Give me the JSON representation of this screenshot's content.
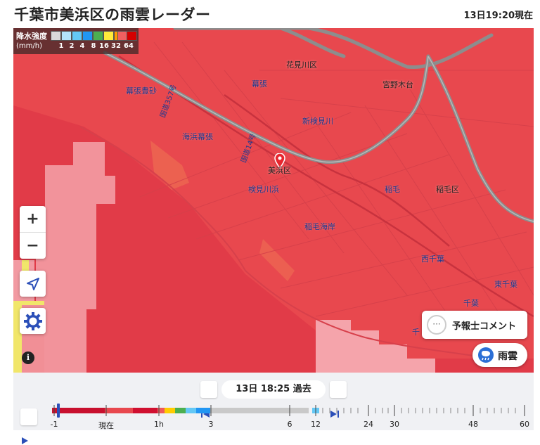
{
  "header": {
    "title": "千葉市美浜区の雨雲レーダー",
    "timestamp": "13日19:20現在"
  },
  "legend": {
    "title": "降水強度",
    "unit": "(mm/h)",
    "values": [
      "1",
      "2",
      "4",
      "8",
      "16",
      "32",
      "64"
    ],
    "colors": [
      "#d9d9d9",
      "#b3e5fc",
      "#64c8f5",
      "#2196f3",
      "#4caf50",
      "#ffeb3b",
      "#ff9800",
      "#f06060",
      "#d50000"
    ]
  },
  "map": {
    "labels": [
      {
        "text": "花見川区",
        "style": "black"
      },
      {
        "text": "幕張",
        "style": "blue"
      },
      {
        "text": "宮野木台",
        "style": "black"
      },
      {
        "text": "幕張豊砂",
        "style": "blue"
      },
      {
        "text": "新検見川",
        "style": "blue"
      },
      {
        "text": "海浜幕張",
        "style": "blue"
      },
      {
        "text": "美浜区",
        "style": "black"
      },
      {
        "text": "検見川浜",
        "style": "blue"
      },
      {
        "text": "稲毛",
        "style": "blue"
      },
      {
        "text": "稲毛区",
        "style": "black"
      },
      {
        "text": "稲毛海岸",
        "style": "blue"
      },
      {
        "text": "西千葉",
        "style": "blue"
      },
      {
        "text": "東千葉",
        "style": "blue"
      },
      {
        "text": "千葉",
        "style": "blue"
      },
      {
        "text": "千",
        "style": "blue"
      }
    ],
    "road_labels": [
      "国道357号",
      "国道14号"
    ],
    "zoom_in": "+",
    "zoom_out": "−",
    "info": "i"
  },
  "buttons": {
    "comment": "予報士コメント",
    "comment_icon": "···",
    "rain": "雨雲"
  },
  "icons": {
    "locate": "navigation-arrow-icon",
    "settings": "gear-icon",
    "pin": "location-pin-icon",
    "rain": "rain-cloud-icon"
  },
  "timeline": {
    "current_time": "13日 18:25 過去",
    "ticks": [
      "-1",
      "現在",
      "1h",
      "3",
      "6",
      "12",
      "24",
      "30",
      "48",
      "60"
    ]
  },
  "colors": {
    "radar_main": "#e8484e",
    "radar_dark": "#e2394a",
    "radar_light": "#f18f96",
    "highway": "#8d8d8d",
    "accent_blue": "#2b4fb8"
  }
}
